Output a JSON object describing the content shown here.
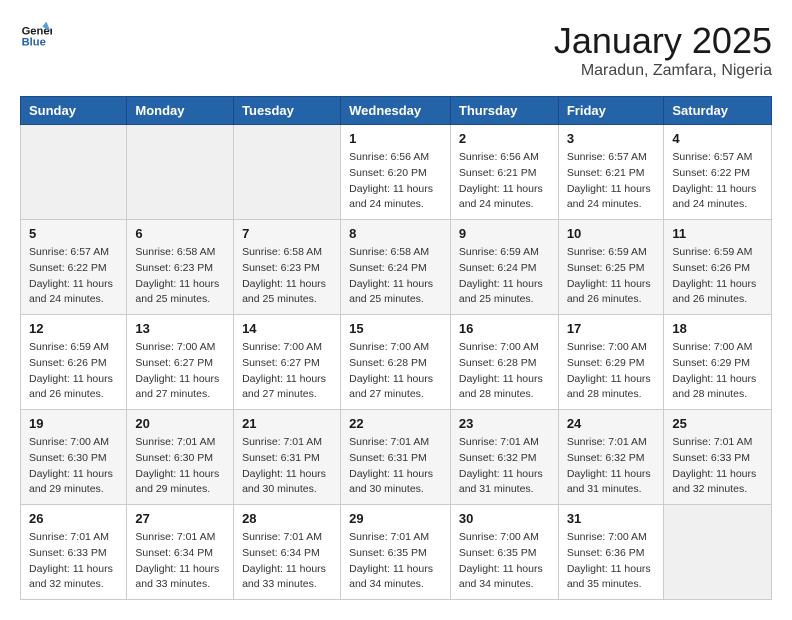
{
  "logo": {
    "line1": "General",
    "line2": "Blue"
  },
  "title": "January 2025",
  "subtitle": "Maradun, Zamfara, Nigeria",
  "weekdays": [
    "Sunday",
    "Monday",
    "Tuesday",
    "Wednesday",
    "Thursday",
    "Friday",
    "Saturday"
  ],
  "weeks": [
    [
      {
        "day": "",
        "info": ""
      },
      {
        "day": "",
        "info": ""
      },
      {
        "day": "",
        "info": ""
      },
      {
        "day": "1",
        "info": "Sunrise: 6:56 AM\nSunset: 6:20 PM\nDaylight: 11 hours\nand 24 minutes."
      },
      {
        "day": "2",
        "info": "Sunrise: 6:56 AM\nSunset: 6:21 PM\nDaylight: 11 hours\nand 24 minutes."
      },
      {
        "day": "3",
        "info": "Sunrise: 6:57 AM\nSunset: 6:21 PM\nDaylight: 11 hours\nand 24 minutes."
      },
      {
        "day": "4",
        "info": "Sunrise: 6:57 AM\nSunset: 6:22 PM\nDaylight: 11 hours\nand 24 minutes."
      }
    ],
    [
      {
        "day": "5",
        "info": "Sunrise: 6:57 AM\nSunset: 6:22 PM\nDaylight: 11 hours\nand 24 minutes."
      },
      {
        "day": "6",
        "info": "Sunrise: 6:58 AM\nSunset: 6:23 PM\nDaylight: 11 hours\nand 25 minutes."
      },
      {
        "day": "7",
        "info": "Sunrise: 6:58 AM\nSunset: 6:23 PM\nDaylight: 11 hours\nand 25 minutes."
      },
      {
        "day": "8",
        "info": "Sunrise: 6:58 AM\nSunset: 6:24 PM\nDaylight: 11 hours\nand 25 minutes."
      },
      {
        "day": "9",
        "info": "Sunrise: 6:59 AM\nSunset: 6:24 PM\nDaylight: 11 hours\nand 25 minutes."
      },
      {
        "day": "10",
        "info": "Sunrise: 6:59 AM\nSunset: 6:25 PM\nDaylight: 11 hours\nand 26 minutes."
      },
      {
        "day": "11",
        "info": "Sunrise: 6:59 AM\nSunset: 6:26 PM\nDaylight: 11 hours\nand 26 minutes."
      }
    ],
    [
      {
        "day": "12",
        "info": "Sunrise: 6:59 AM\nSunset: 6:26 PM\nDaylight: 11 hours\nand 26 minutes."
      },
      {
        "day": "13",
        "info": "Sunrise: 7:00 AM\nSunset: 6:27 PM\nDaylight: 11 hours\nand 27 minutes."
      },
      {
        "day": "14",
        "info": "Sunrise: 7:00 AM\nSunset: 6:27 PM\nDaylight: 11 hours\nand 27 minutes."
      },
      {
        "day": "15",
        "info": "Sunrise: 7:00 AM\nSunset: 6:28 PM\nDaylight: 11 hours\nand 27 minutes."
      },
      {
        "day": "16",
        "info": "Sunrise: 7:00 AM\nSunset: 6:28 PM\nDaylight: 11 hours\nand 28 minutes."
      },
      {
        "day": "17",
        "info": "Sunrise: 7:00 AM\nSunset: 6:29 PM\nDaylight: 11 hours\nand 28 minutes."
      },
      {
        "day": "18",
        "info": "Sunrise: 7:00 AM\nSunset: 6:29 PM\nDaylight: 11 hours\nand 28 minutes."
      }
    ],
    [
      {
        "day": "19",
        "info": "Sunrise: 7:00 AM\nSunset: 6:30 PM\nDaylight: 11 hours\nand 29 minutes."
      },
      {
        "day": "20",
        "info": "Sunrise: 7:01 AM\nSunset: 6:30 PM\nDaylight: 11 hours\nand 29 minutes."
      },
      {
        "day": "21",
        "info": "Sunrise: 7:01 AM\nSunset: 6:31 PM\nDaylight: 11 hours\nand 30 minutes."
      },
      {
        "day": "22",
        "info": "Sunrise: 7:01 AM\nSunset: 6:31 PM\nDaylight: 11 hours\nand 30 minutes."
      },
      {
        "day": "23",
        "info": "Sunrise: 7:01 AM\nSunset: 6:32 PM\nDaylight: 11 hours\nand 31 minutes."
      },
      {
        "day": "24",
        "info": "Sunrise: 7:01 AM\nSunset: 6:32 PM\nDaylight: 11 hours\nand 31 minutes."
      },
      {
        "day": "25",
        "info": "Sunrise: 7:01 AM\nSunset: 6:33 PM\nDaylight: 11 hours\nand 32 minutes."
      }
    ],
    [
      {
        "day": "26",
        "info": "Sunrise: 7:01 AM\nSunset: 6:33 PM\nDaylight: 11 hours\nand 32 minutes."
      },
      {
        "day": "27",
        "info": "Sunrise: 7:01 AM\nSunset: 6:34 PM\nDaylight: 11 hours\nand 33 minutes."
      },
      {
        "day": "28",
        "info": "Sunrise: 7:01 AM\nSunset: 6:34 PM\nDaylight: 11 hours\nand 33 minutes."
      },
      {
        "day": "29",
        "info": "Sunrise: 7:01 AM\nSunset: 6:35 PM\nDaylight: 11 hours\nand 34 minutes."
      },
      {
        "day": "30",
        "info": "Sunrise: 7:00 AM\nSunset: 6:35 PM\nDaylight: 11 hours\nand 34 minutes."
      },
      {
        "day": "31",
        "info": "Sunrise: 7:00 AM\nSunset: 6:36 PM\nDaylight: 11 hours\nand 35 minutes."
      },
      {
        "day": "",
        "info": ""
      }
    ]
  ]
}
